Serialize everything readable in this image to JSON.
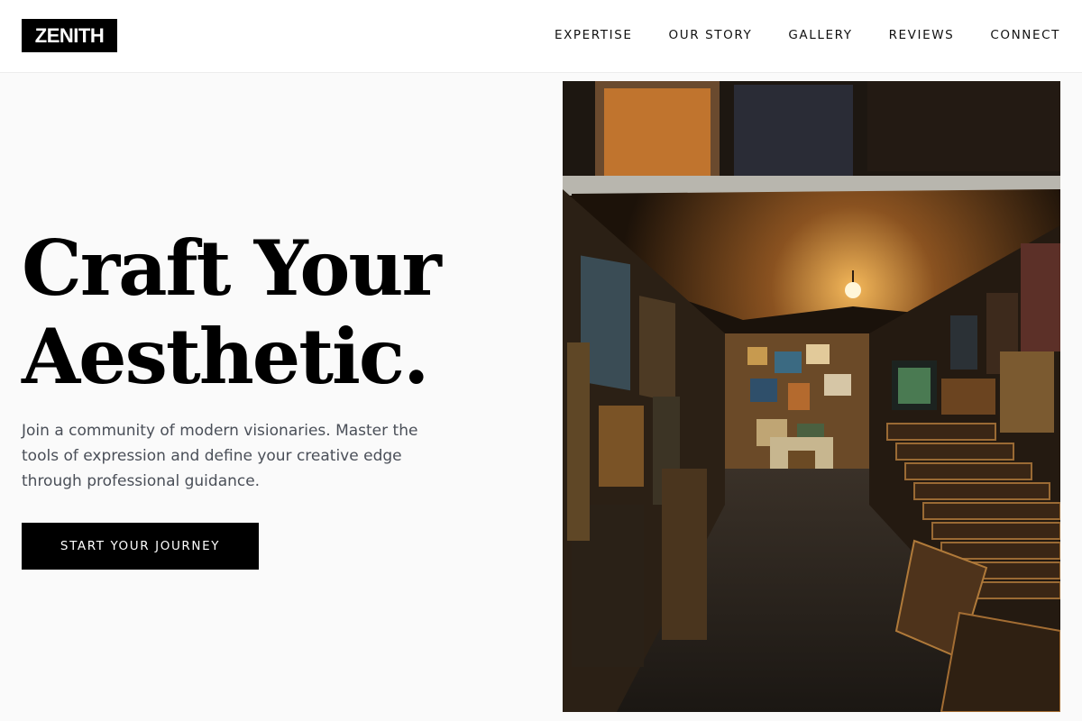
{
  "brand": {
    "logo": "ZENITH"
  },
  "nav": {
    "items": [
      {
        "label": "EXPERTISE"
      },
      {
        "label": "OUR STORY"
      },
      {
        "label": "GALLERY"
      },
      {
        "label": "REVIEWS"
      },
      {
        "label": "CONNECT"
      }
    ]
  },
  "hero": {
    "title_line1": "Craft Your",
    "title_line2": "Aesthetic.",
    "description": "Join a community of modern visionaries. Master the tools of expression and define your creative edge through professional guidance.",
    "cta_label": "START YOUR JOURNEY",
    "image_alt": "art-gallery-corridor-photo"
  },
  "colors": {
    "primary": "#000000",
    "background": "#fafafa",
    "header_bg": "#ffffff",
    "text_muted": "#4a4f58"
  }
}
